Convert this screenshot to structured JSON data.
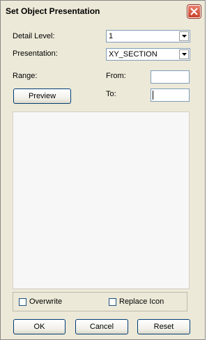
{
  "window": {
    "title": "Set Object Presentation"
  },
  "fields": {
    "detail_level_label": "Detail Level:",
    "detail_level_value": "1",
    "presentation_label": "Presentation:",
    "presentation_value": "XY_SECTION",
    "range_label": "Range:",
    "from_label": "From:",
    "from_value": "",
    "to_label": "To:",
    "to_value": ""
  },
  "buttons": {
    "preview": "Preview",
    "ok": "OK",
    "cancel": "Cancel",
    "reset": "Reset"
  },
  "options": {
    "overwrite_label": "Overwrite",
    "overwrite_checked": false,
    "replace_icon_label": "Replace Icon",
    "replace_icon_checked": false
  },
  "icons": {
    "close": "close-icon",
    "dropdown": "chevron-down-icon"
  },
  "colors": {
    "dialog_bg": "#ece9d8",
    "close_button": "#c9402a",
    "input_border": "#7f9db9"
  }
}
